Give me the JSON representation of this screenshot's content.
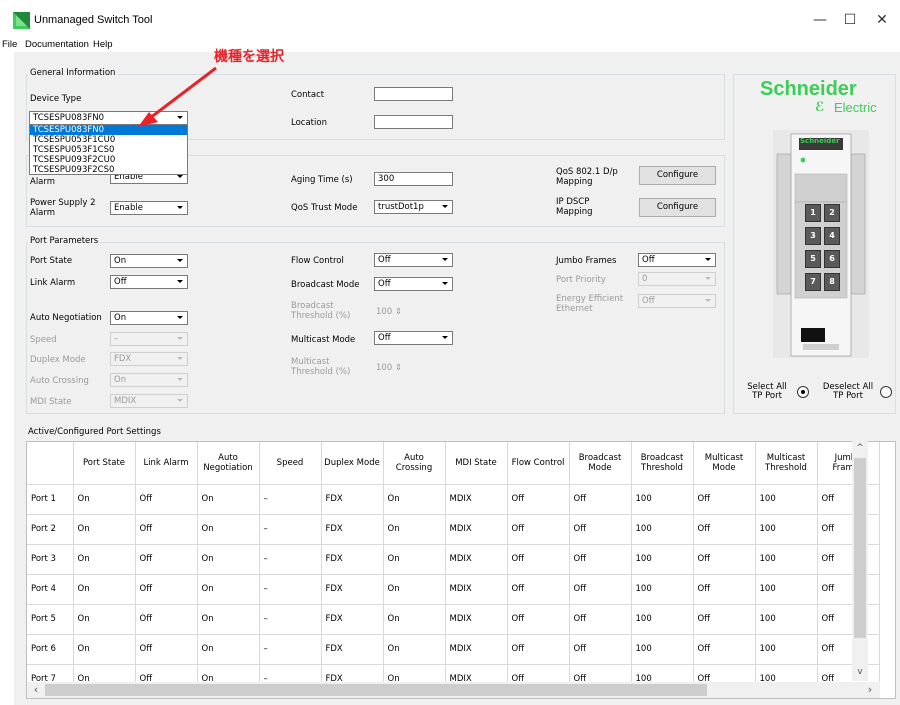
{
  "window": {
    "title": "Unmanaged Switch Tool",
    "controls": {
      "minimize": "—",
      "maximize": "☐",
      "close": "✕"
    }
  },
  "menu": [
    "File",
    "Documentation",
    "Help"
  ],
  "annotation": {
    "text": "機種を選択",
    "color": "#e8242a"
  },
  "general": {
    "group_label": "General Information",
    "device_type_label": "Device Type",
    "device_type_value": "TCSESPU083FN0",
    "device_options": [
      "TCSESPU083FN0",
      "TCSESPU053F1CU0",
      "TCSESPU053F1CS0",
      "TCSESPU093F2CU0",
      "TCSESPU093F2CS0"
    ],
    "contact_label": "Contact",
    "contact_value": "",
    "location_label": "Location",
    "location_value": ""
  },
  "switch": {
    "ps1_label": "Alarm",
    "ps1_value": "Enable",
    "ps2_label": "Power Supply 2 Alarm",
    "ps2_value": "Enable",
    "aging_label": "Aging Time (s)",
    "aging_value": "300",
    "qos_trust_label": "QoS Trust Mode",
    "qos_trust_value": "trustDot1p",
    "qos_mapping_label": "QoS 802.1 D/p Mapping",
    "ip_dscp_label": "IP DSCP Mapping",
    "configure_label": "Configure"
  },
  "port_params": {
    "group_label": "Port Parameters",
    "port_state_label": "Port State",
    "port_state_value": "On",
    "link_alarm_label": "Link Alarm",
    "link_alarm_value": "Off",
    "auto_neg_label": "Auto Negotiation",
    "auto_neg_value": "On",
    "speed_label": "Speed",
    "speed_value": "–",
    "duplex_label": "Duplex Mode",
    "duplex_value": "FDX",
    "auto_cross_label": "Auto Crossing",
    "auto_cross_value": "On",
    "mdi_label": "MDI State",
    "mdi_value": "MDIX",
    "flow_label": "Flow Control",
    "flow_value": "Off",
    "bcast_mode_label": "Broadcast Mode",
    "bcast_mode_value": "Off",
    "bcast_thr_label": "Broadcast Threshold (%)",
    "bcast_thr_value": "100",
    "mcast_mode_label": "Multicast Mode",
    "mcast_mode_value": "Off",
    "mcast_thr_label": "Multicast Threshold (%)",
    "mcast_thr_value": "100",
    "jumbo_label": "Jumbo Frames",
    "jumbo_value": "Off",
    "priority_label": "Port Priority",
    "priority_value": "0",
    "eee_label": "Energy Efficient Ethernet",
    "eee_value": "Off"
  },
  "side": {
    "logo_top": "Schneider",
    "logo_bottom": "Electric",
    "device_brand": "Schneider",
    "ports": [
      "1",
      "2",
      "3",
      "4",
      "5",
      "6",
      "7",
      "8"
    ],
    "select_all": "Select All TP Port",
    "deselect_all": "Deselect All TP Port",
    "brand_color": "#3dcd58"
  },
  "table": {
    "group_label": "Active/Configured Port Settings",
    "headers": [
      "",
      "Port State",
      "Link Alarm",
      "Auto Negotiation",
      "Speed",
      "Duplex Mode",
      "Auto Crossing",
      "MDI State",
      "Flow Control",
      "Broadcast Mode",
      "Broadcast Threshold",
      "Multicast Mode",
      "Multicast Threshold",
      "Jumbo Frames"
    ],
    "rows": [
      [
        "Port 1",
        "On",
        "Off",
        "On",
        "–",
        "FDX",
        "On",
        "MDIX",
        "Off",
        "Off",
        "100",
        "Off",
        "100",
        "Off"
      ],
      [
        "Port 2",
        "On",
        "Off",
        "On",
        "–",
        "FDX",
        "On",
        "MDIX",
        "Off",
        "Off",
        "100",
        "Off",
        "100",
        "Off"
      ],
      [
        "Port 3",
        "On",
        "Off",
        "On",
        "–",
        "FDX",
        "On",
        "MDIX",
        "Off",
        "Off",
        "100",
        "Off",
        "100",
        "Off"
      ],
      [
        "Port 4",
        "On",
        "Off",
        "On",
        "–",
        "FDX",
        "On",
        "MDIX",
        "Off",
        "Off",
        "100",
        "Off",
        "100",
        "Off"
      ],
      [
        "Port 5",
        "On",
        "Off",
        "On",
        "–",
        "FDX",
        "On",
        "MDIX",
        "Off",
        "Off",
        "100",
        "Off",
        "100",
        "Off"
      ],
      [
        "Port 6",
        "On",
        "Off",
        "On",
        "–",
        "FDX",
        "On",
        "MDIX",
        "Off",
        "Off",
        "100",
        "Off",
        "100",
        "Off"
      ],
      [
        "Port 7",
        "On",
        "Off",
        "On",
        "–",
        "FDX",
        "On",
        "MDIX",
        "Off",
        "Off",
        "100",
        "Off",
        "100",
        "Off"
      ]
    ]
  }
}
